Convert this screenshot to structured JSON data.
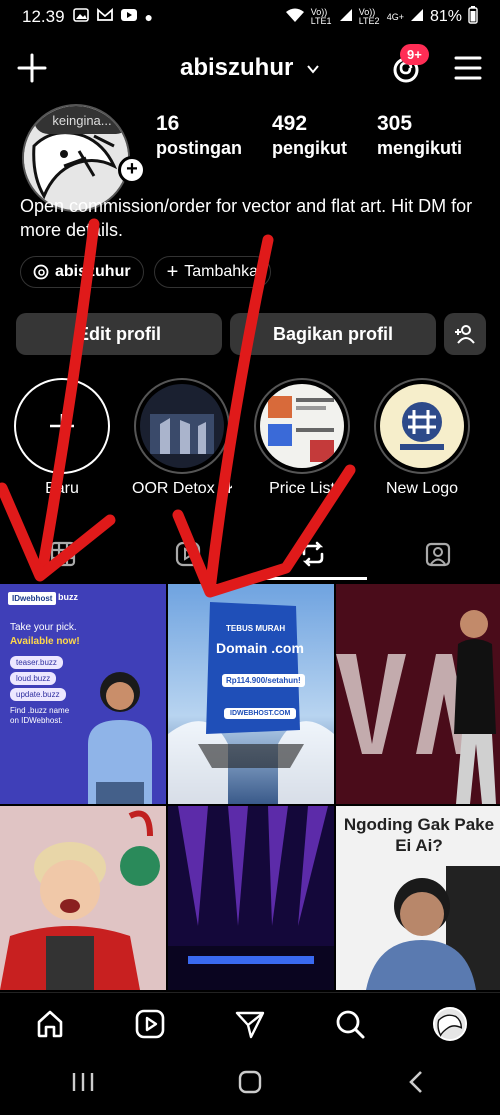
{
  "status_bar": {
    "time": "12.39",
    "net1": "Vo)) LTE1",
    "net2": "Vo)) LTE2",
    "net3": "4G+",
    "battery": "81%"
  },
  "header": {
    "username": "abiszuhur",
    "notification_badge": "9+"
  },
  "profile": {
    "note": "keingina...",
    "stats": [
      {
        "num": "16",
        "label": "postingan"
      },
      {
        "num": "492",
        "label": "pengikut"
      },
      {
        "num": "305",
        "label": "mengikuti"
      }
    ],
    "bio": "Open commission/order for vector and flat art. Hit DM for more details.",
    "threads_chip": "abiszuhur",
    "add_chip": "Tambahka"
  },
  "actions": {
    "edit": "Edit profil",
    "share": "Bagikan profil"
  },
  "highlights": [
    {
      "label": "Baru"
    },
    {
      "label": "OOR Detox JKT"
    },
    {
      "label": "Price List"
    },
    {
      "label": "New Logo"
    }
  ],
  "grid": {
    "post1": {
      "brand": "IDwebhost",
      "brand2": "buzz",
      "line1": "Take your pick.",
      "line2": "Available now!",
      "pills": [
        "teaser.buzz",
        "loud.buzz",
        "update.buzz"
      ],
      "foot": "Find .buzz name on IDWebhost."
    },
    "post2": {
      "head": "TEBUS MURAH",
      "domain": "Domain .com",
      "price": "Rp114.900/setahun!",
      "site": "IDWEBHOST.COM"
    },
    "post6": {
      "caption": "Ngoding Gak Pake Ei Ai?"
    }
  },
  "colors": {
    "accent_red": "#ff2d55",
    "arrow_red": "#e01a1a",
    "button_bg": "#363636"
  }
}
